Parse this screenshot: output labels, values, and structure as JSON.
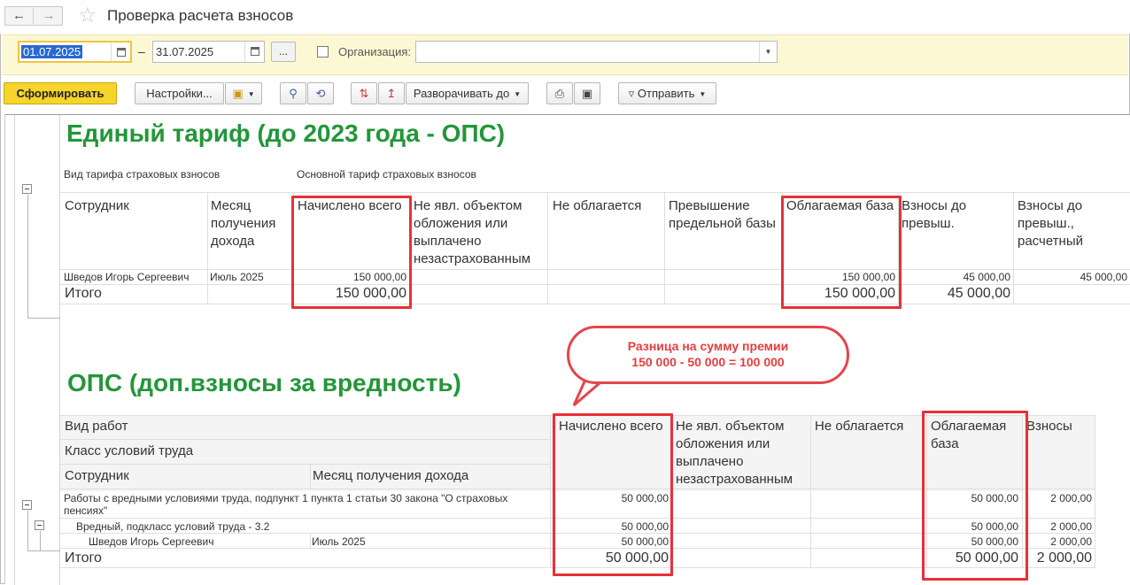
{
  "window": {
    "title": "Проверка расчета взносов"
  },
  "filters": {
    "date_from": "01.07.2025",
    "date_to": "31.07.2025",
    "dash": "–",
    "dots": "...",
    "org_label": "Организация:",
    "org_value": ""
  },
  "toolbar": {
    "generate": "Сформировать",
    "settings": "Настройки...",
    "expand": "Разворачивать до",
    "send": "Отправить"
  },
  "section1": {
    "title": "Единый тариф (до 2023 года - ОПС)",
    "param_label": "Вид тарифа страховых взносов",
    "param_value": "Основной тариф страховых взносов",
    "headers": {
      "employee": "Сотрудник",
      "month": "Месяц получения дохода",
      "accrued": "Начислено всего",
      "not_object": "Не явл. объектом обложения или выплачено незастрахованным",
      "not_taxed": "Не облагается",
      "excess": "Превышение предельной базы",
      "base": "Облагаемая база",
      "contrib_before": "Взносы до превыш.",
      "contrib_calc": "Взносы до превыш., расчетный"
    },
    "row": {
      "employee": "Шведов Игорь Сергеевич",
      "month": "Июль 2025",
      "accrued": "150 000,00",
      "base": "150 000,00",
      "contrib_before": "45 000,00",
      "contrib_calc": "45 000,00"
    },
    "total": {
      "label": "Итого",
      "accrued": "150 000,00",
      "base": "150 000,00",
      "contrib_before": "45 000,00"
    }
  },
  "callout": {
    "line1": "Разница на сумму премии",
    "line2": "150 000 - 50 000 = 100 000"
  },
  "section2": {
    "title": "ОПС (доп.взносы за вредность)",
    "headers": {
      "work_type": "Вид работ",
      "work_class": "Класс условий труда",
      "employee": "Сотрудник",
      "month": "Месяц получения дохода",
      "accrued": "Начислено всего",
      "not_object": "Не явл. объектом обложения или выплачено незастрахованным",
      "not_taxed": "Не облагается",
      "base": "Облагаемая база",
      "contrib": "Взносы"
    },
    "rows": [
      {
        "label": "Работы с вредными условиями труда, подпункт 1 пункта 1 статьи 30 закона \"О страховых пенсиях\"",
        "accrued": "50 000,00",
        "base": "50 000,00",
        "contrib": "2 000,00"
      },
      {
        "label": "Вредный, подкласс условий труда - 3.2",
        "accrued": "50 000,00",
        "base": "50 000,00",
        "contrib": "2 000,00"
      },
      {
        "label": "Шведов Игорь Сергеевич",
        "month": "Июль 2025",
        "accrued": "50 000,00",
        "base": "50 000,00",
        "contrib": "2 000,00"
      }
    ],
    "total": {
      "label": "Итого",
      "accrued": "50 000,00",
      "base": "50 000,00",
      "contrib": "2 000,00"
    }
  },
  "colors": {
    "heading_green": "#23963a",
    "highlight_red": "#e53238",
    "primary_button": "#f6d52b",
    "filter_bar": "#fdf8d4"
  }
}
